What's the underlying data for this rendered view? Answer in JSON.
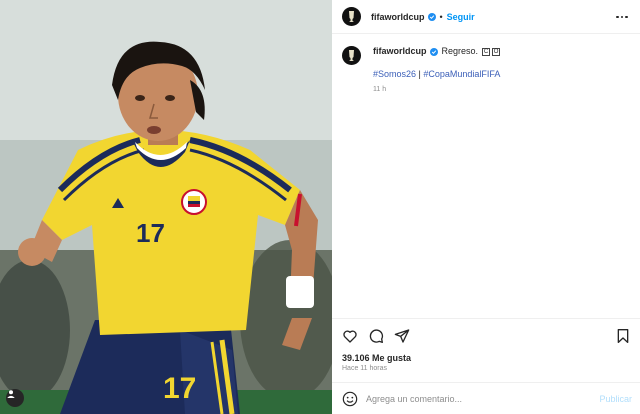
{
  "post": {
    "username": "fifaworldcup",
    "follow_label": "Seguir",
    "separator": "•"
  },
  "caption": {
    "username": "fifaworldcup",
    "text": "Regreso.",
    "flag": [
      "C",
      "O"
    ],
    "hashtag_1": "#Somos26",
    "hashtag_sep": " | ",
    "hashtag_2": "#CopaMundialFIFA",
    "time": "11 h"
  },
  "photo": {
    "jersey_number": "17",
    "shorts_number": "17"
  },
  "stats": {
    "likes": "39.106 Me gusta",
    "posted_ago": "Hace 11 horas"
  },
  "comment": {
    "placeholder": "Agrega un comentario...",
    "publish_label": "Publicar"
  },
  "colors": {
    "link_blue": "#0095f6",
    "verified_blue": "#1f8ef1",
    "jersey_yellow": "#f2d630",
    "jersey_navy": "#1c2b5a",
    "accent_red": "#c8102e"
  },
  "icons": [
    "like-heart-icon",
    "comment-bubble-icon",
    "share-send-icon",
    "save-bookmark-icon",
    "emoji-icon",
    "more-options-icon",
    "tag-user-icon",
    "verified-badge-icon"
  ]
}
